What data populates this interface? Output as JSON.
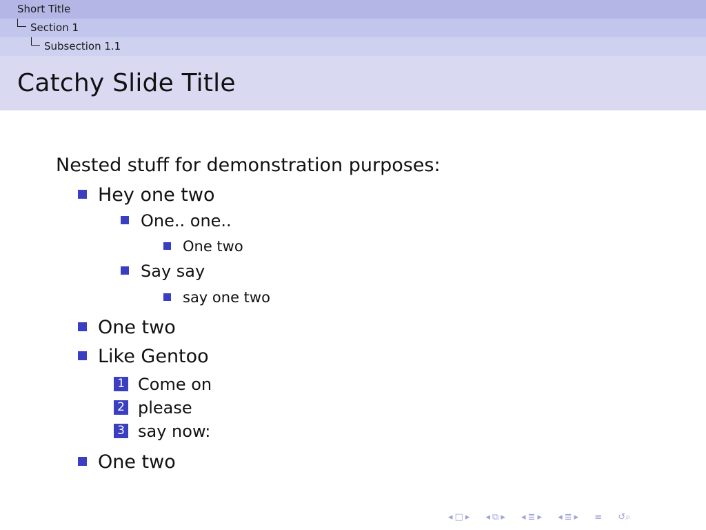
{
  "header": {
    "short_title": "Short Title",
    "section": "Section 1",
    "subsection": "Subsection 1.1"
  },
  "slide": {
    "title": "Catchy Slide Title",
    "intro": "Nested stuff for demonstration purposes:",
    "items": [
      {
        "text": "Hey one two",
        "children": [
          {
            "text": "One.. one..",
            "children": [
              {
                "text": "One two"
              }
            ]
          },
          {
            "text": "Say say",
            "children": [
              {
                "text": "say one two"
              }
            ]
          }
        ]
      },
      {
        "text": "One two"
      },
      {
        "text": "Like Gentoo",
        "enumerate": [
          {
            "number": "1",
            "text": "Come on"
          },
          {
            "number": "2",
            "text": "please"
          },
          {
            "number": "3",
            "text": "say now:"
          }
        ]
      },
      {
        "text": "One two"
      }
    ]
  },
  "colors": {
    "accent": "#3a3ec0",
    "header_row1": "#b4b7e6",
    "header_row2": "#c3c6ec",
    "header_row3": "#cfd1f0",
    "title_bar": "#d9daf2",
    "nav_symbols": "#a0a3d8"
  },
  "navigation": {
    "icons": [
      "nav-slide-left-icon",
      "nav-slide-icon",
      "nav-slide-right-icon",
      "nav-frame-left-icon",
      "nav-frame-icon",
      "nav-frame-right-icon",
      "nav-subsection-left-icon",
      "nav-subsection-icon",
      "nav-subsection-right-icon",
      "nav-section-left-icon",
      "nav-section-icon",
      "nav-section-right-icon",
      "nav-document-icon",
      "nav-search-icon"
    ]
  }
}
